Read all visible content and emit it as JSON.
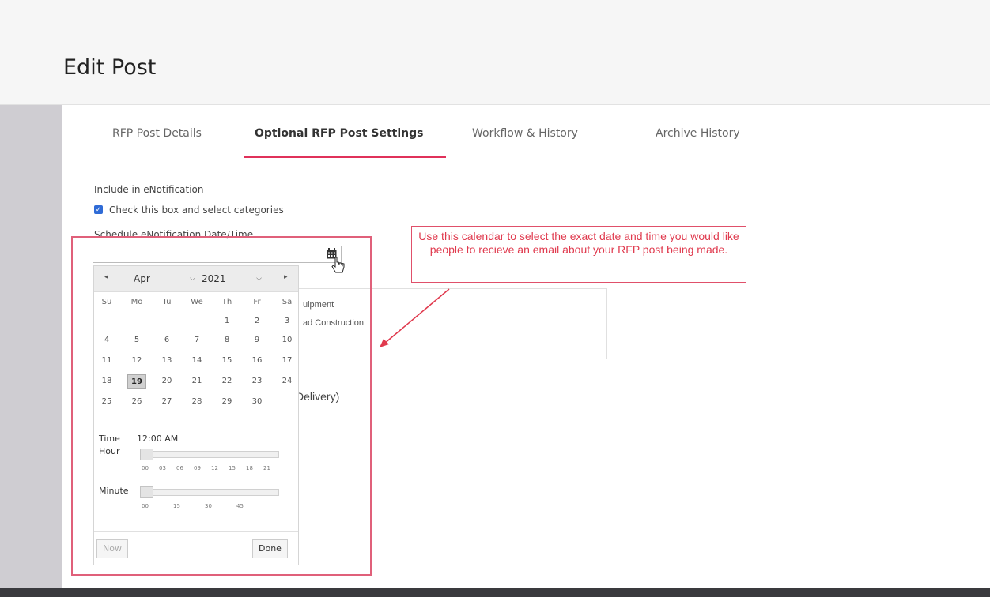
{
  "header": {
    "title": "Edit Post"
  },
  "tabs": [
    {
      "label": "RFP Post Details"
    },
    {
      "label": "Optional RFP Post Settings"
    },
    {
      "label": "Workflow & History"
    },
    {
      "label": "Archive History"
    }
  ],
  "form": {
    "include_label": "Include in eNotification",
    "checkbox_label": "Check this box and select categories",
    "checkbox_checked": true,
    "schedule_label": "Schedule eNotification Date/Time",
    "date_value": ""
  },
  "categories_partial": [
    "uipment",
    "ad Construction"
  ],
  "background_text": "Delivery)",
  "datepicker": {
    "month": "Apr",
    "year": "2021",
    "prev": "◂",
    "next": "▸",
    "weekdays": [
      "Su",
      "Mo",
      "Tu",
      "We",
      "Th",
      "Fr",
      "Sa"
    ],
    "weeks": [
      [
        "",
        "",
        "",
        "",
        "1",
        "2",
        "3"
      ],
      [
        "4",
        "5",
        "6",
        "7",
        "8",
        "9",
        "10"
      ],
      [
        "11",
        "12",
        "13",
        "14",
        "15",
        "16",
        "17"
      ],
      [
        "18",
        "19",
        "20",
        "21",
        "22",
        "23",
        "24"
      ],
      [
        "25",
        "26",
        "27",
        "28",
        "29",
        "30",
        ""
      ]
    ],
    "selected_day": "19",
    "time_label": "Time",
    "time_value": "12:00 AM",
    "hour_label": "Hour",
    "hour_ticks": [
      "00",
      "03",
      "06",
      "09",
      "12",
      "15",
      "18",
      "21"
    ],
    "minute_label": "Minute",
    "minute_ticks": [
      "00",
      "15",
      "30",
      "45"
    ],
    "now_label": "Now",
    "done_label": "Done",
    "hour_value": 0,
    "minute_value": 0
  },
  "callout": {
    "text": "Use this calendar to select the exact date and time you would like people to recieve an email about your RFP post being made."
  },
  "colors": {
    "accent": "#e0315a",
    "callout": "#e03a4e",
    "checkbox": "#2f6bd6"
  },
  "icons": [
    "calendar-icon",
    "pointer-cursor-icon",
    "chevron-down-icon",
    "prev-arrow-icon",
    "next-arrow-icon"
  ]
}
